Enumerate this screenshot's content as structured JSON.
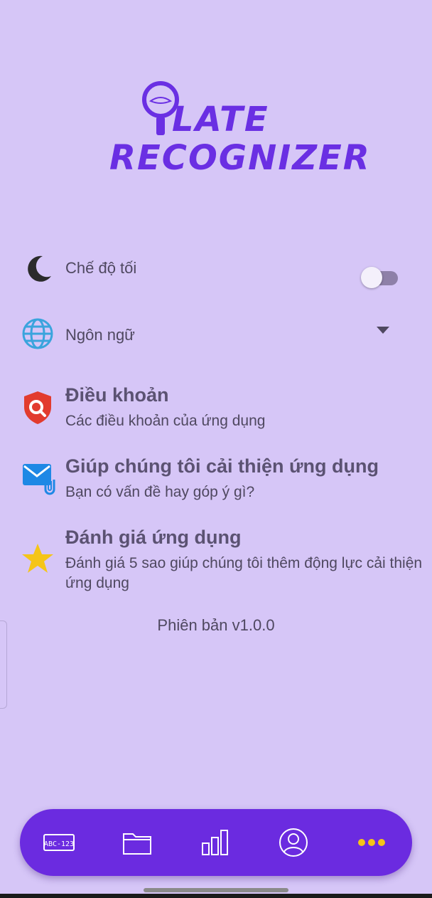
{
  "app": {
    "logo_line1": "LATE",
    "logo_line2": "RECOGNIZER"
  },
  "settings": {
    "dark_mode": {
      "label": "Chế độ tối",
      "enabled": false,
      "icon": "moon-icon"
    },
    "language": {
      "label": "Ngôn ngữ",
      "icon": "globe-icon"
    }
  },
  "items": [
    {
      "title": "Điều khoản",
      "subtitle": "Các điều khoản của ứng dụng",
      "icon": "shield-search-icon"
    },
    {
      "title": "Giúp chúng tôi cải thiện ứng dụng",
      "subtitle": "Bạn có vấn đề hay góp ý gì?",
      "icon": "mail-attachment-icon"
    },
    {
      "title": "Đánh giá ứng dụng",
      "subtitle": "Đánh giá 5 sao giúp chúng tôi thêm động lực cải thiện ứng dụng",
      "icon": "star-icon"
    }
  ],
  "version_text": "Phiên bản v1.0.0",
  "bottom_nav": {
    "items": [
      {
        "icon": "license-plate-icon",
        "plate_text": "ABC-123"
      },
      {
        "icon": "folder-icon"
      },
      {
        "icon": "bar-chart-icon"
      },
      {
        "icon": "profile-icon"
      },
      {
        "icon": "more-dots-icon",
        "active": true
      }
    ]
  },
  "colors": {
    "background": "#d6c6f7",
    "accent": "#6b2be0",
    "active_nav": "#f5c518",
    "logo": "#6a2fe3"
  }
}
